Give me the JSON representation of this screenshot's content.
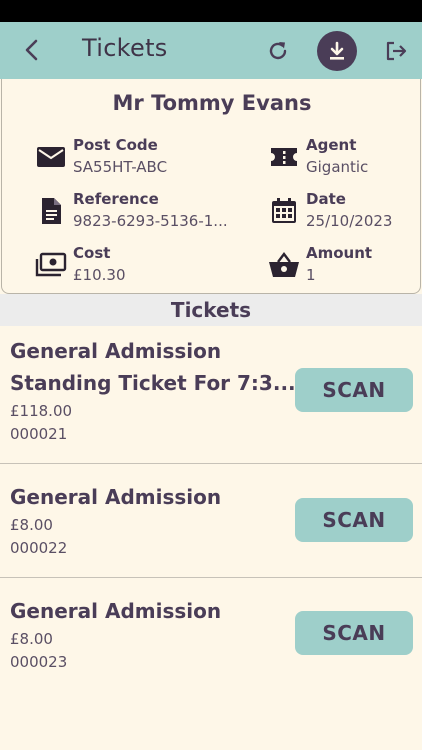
{
  "header": {
    "title": "Tickets"
  },
  "order": {
    "customer_name": "Mr Tommy Evans",
    "post_code": {
      "label": "Post Code",
      "value": "SA55HT-ABC"
    },
    "agent": {
      "label": "Agent",
      "value": "Gigantic"
    },
    "reference": {
      "label": "Reference",
      "value": "9823-6293-5136-1..."
    },
    "date": {
      "label": "Date",
      "value": "25/10/2023"
    },
    "cost": {
      "label": "Cost",
      "value": "£10.30"
    },
    "amount": {
      "label": "Amount",
      "value": "1"
    }
  },
  "tickets_section": {
    "title": "Tickets"
  },
  "tickets": [
    {
      "name_line1": "General Admission",
      "name_line2": "Standing Ticket For 7:3...",
      "price": "£118.00",
      "code": "000021",
      "scan_label": "SCAN"
    },
    {
      "name_line1": "General Admission",
      "price": "£8.00",
      "code": "000022",
      "scan_label": "SCAN"
    },
    {
      "name_line1": "General Admission",
      "price": "£8.00",
      "code": "000023",
      "scan_label": "SCAN"
    }
  ],
  "colors": {
    "accent": "#9ecfca",
    "text": "#4a3d57",
    "background": "#fef7e8"
  }
}
